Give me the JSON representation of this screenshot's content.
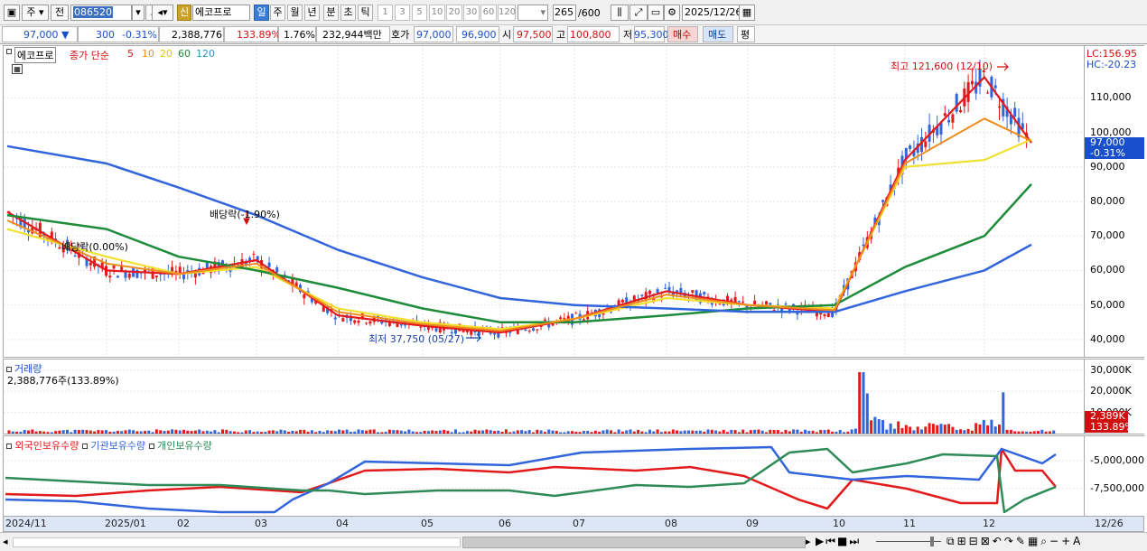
{
  "toolbar": {
    "type_label": "주",
    "prev_label": "전",
    "code_value": "086520",
    "badge_label": "신",
    "name_value": "에코프로",
    "periods": [
      "일",
      "주",
      "월",
      "년",
      "분",
      "초",
      "틱"
    ],
    "selected_period": "일",
    "nums": [
      "1",
      "3",
      "5",
      "10",
      "20",
      "30",
      "60",
      "120"
    ],
    "count_value": "265",
    "count_total": "/600",
    "date_value": "2025/12/26"
  },
  "quote": {
    "price": "97,000",
    "change": "300",
    "change_pct": "-0.31%",
    "volume": "2,388,776",
    "volume_ratio": "133.89%",
    "turnover_pct": "1.76%",
    "amount": "232,944백만",
    "bid_label": "호가",
    "bid": "97,000",
    "ask": "96,900",
    "open_label": "시",
    "open": "97,500",
    "high_label": "고",
    "high": "100,800",
    "low_label": "저",
    "low": "95,300",
    "buy_label": "매수",
    "sell_label": "매도",
    "eval_label": "평"
  },
  "price_panel": {
    "name": "에코프로",
    "legend_prefix": "종가 단순",
    "ma": [
      {
        "label": "5",
        "color": "#e31a1c"
      },
      {
        "label": "10",
        "color": "#f08c1e"
      },
      {
        "label": "20",
        "color": "#f2e030"
      },
      {
        "label": "60",
        "color": "#1e8c3a"
      },
      {
        "label": "120",
        "color": "#3264dc"
      }
    ],
    "lc": "LC:156.95",
    "hc": "HC:-20.23",
    "price_tag": "97,000",
    "price_tag_pct": "-0.31%",
    "yticks": [
      "110,000",
      "100,000",
      "90,000",
      "80,000",
      "70,000",
      "60,000",
      "50,000",
      "40,000"
    ],
    "annot_high": "최고 121,600 (12/10)",
    "annot_low": "최저 37,750 (05/27)",
    "annot_div1": "배당락(-1.90%)",
    "annot_div2": "배당락(0.00%)"
  },
  "volume_panel": {
    "title": "거래량",
    "value": "2,388,776주(133.89%)",
    "yticks": [
      "30,000K",
      "20,000K",
      "10,000K"
    ],
    "tag": "2,389K",
    "tag_pct": "133.89%"
  },
  "holdings_panel": {
    "series": [
      {
        "label": "외국인보유수량",
        "color": "#e31a1c"
      },
      {
        "label": "기관보유수량",
        "color": "#3264dc"
      },
      {
        "label": "개인보유수량",
        "color": "#2e8b57"
      }
    ],
    "yticks": [
      "-5,000,000",
      "-7,500,000"
    ]
  },
  "xaxis": {
    "labels": [
      "2024/11",
      "2025/01",
      "02",
      "03",
      "04",
      "05",
      "06",
      "07",
      "08",
      "09",
      "10",
      "11",
      "12"
    ],
    "end_label": "12/26"
  },
  "chart_data": {
    "type": "line",
    "title": "에코프로",
    "x": [
      "2024/11",
      "2025/01",
      "02",
      "03",
      "04",
      "05",
      "06",
      "07",
      "08",
      "09",
      "10",
      "11",
      "12",
      "12/26"
    ],
    "series": [
      {
        "name": "5",
        "values": [
          77000,
          60000,
          59000,
          63000,
          47000,
          44000,
          42000,
          46000,
          54000,
          50000,
          48000,
          92000,
          116000,
          97000
        ]
      },
      {
        "name": "20",
        "values": [
          72000,
          64000,
          59000,
          61000,
          49000,
          45000,
          43000,
          46000,
          52000,
          50000,
          49000,
          90000,
          92000,
          98000
        ]
      },
      {
        "name": "60",
        "values": [
          76000,
          72000,
          64000,
          60000,
          55000,
          49000,
          45000,
          45000,
          47000,
          49000,
          50000,
          61000,
          70000,
          85000
        ]
      },
      {
        "name": "120",
        "values": [
          96000,
          91000,
          84000,
          76000,
          66000,
          58000,
          52000,
          50000,
          49000,
          48000,
          48000,
          54000,
          60000,
          67500
        ]
      }
    ],
    "ylim": [
      35000,
      125000
    ],
    "volume_ylim": [
      0,
      35000
    ]
  }
}
